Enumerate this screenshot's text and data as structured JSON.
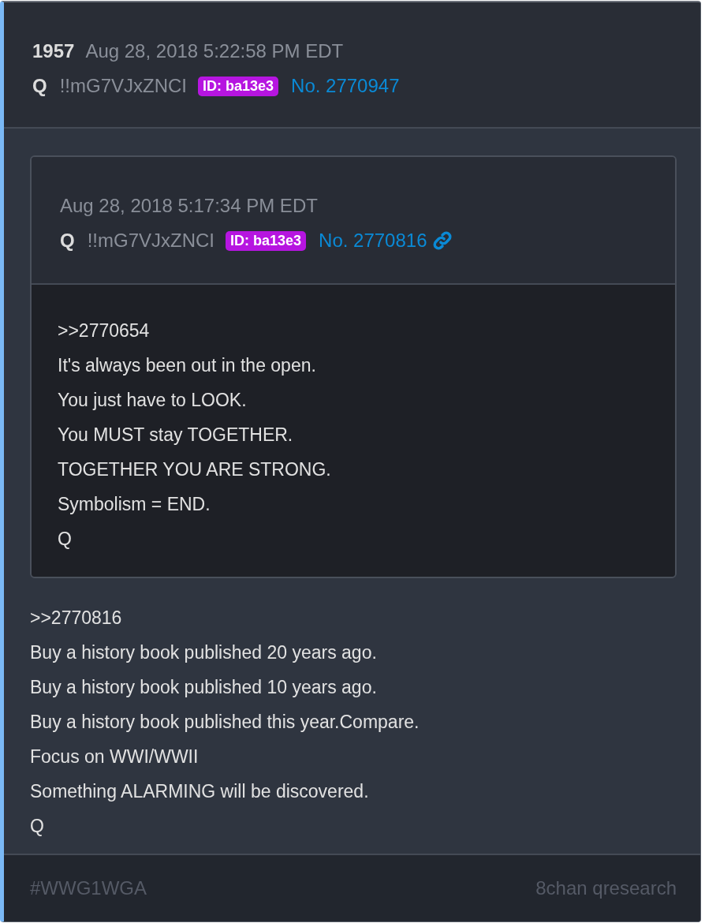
{
  "post": {
    "number": "1957",
    "date": "Aug 28, 2018 5:22:58 PM EDT",
    "author": "Q",
    "tripcode": "!!mG7VJxZNCI",
    "id_badge": "ID: ba13e3",
    "post_no": "No. 2770947"
  },
  "quote": {
    "date": "Aug 28, 2018 5:17:34 PM EDT",
    "author": "Q",
    "tripcode": "!!mG7VJxZNCI",
    "id_badge": "ID: ba13e3",
    "post_no": "No. 2770816",
    "lines": [
      ">>2770654",
      "It's always been out in the open.",
      "You just have to LOOK.",
      "You MUST stay TOGETHER.",
      "TOGETHER YOU ARE STRONG.",
      "Symbolism = END.",
      "Q"
    ]
  },
  "lines": [
    ">>2770816",
    "Buy a history book published 20 years ago.",
    "Buy a history book published 10 years ago.",
    "Buy a history book published this year.Compare.",
    "Focus on WWI/WWII",
    "Something ALARMING will be discovered.",
    "Q"
  ],
  "footer": {
    "hashtag": "#WWG1WGA",
    "source": "8chan qresearch"
  }
}
